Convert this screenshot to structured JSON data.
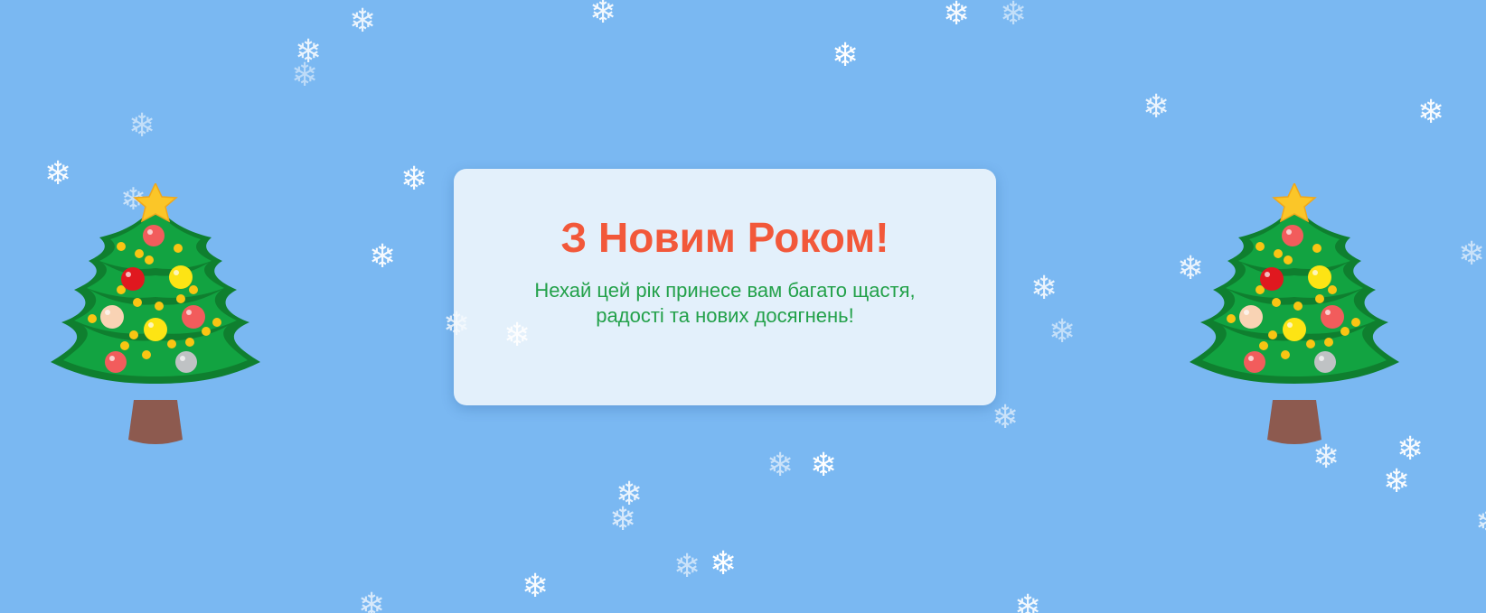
{
  "card": {
    "title": "З Новим Роком!",
    "message": "Нехай цей рік принесе вам багато щастя, радості та нових досягнень!"
  },
  "decorations": {
    "snowflake_glyph": "❄",
    "left_tree_icon": "christmas-tree-icon",
    "right_tree_icon": "christmas-tree-icon"
  },
  "colors": {
    "background": "#7ab8f2",
    "card_background": "#e3f0fb",
    "title": "#f2583a",
    "message": "#23a14a",
    "snowflake": "#ffffff"
  }
}
